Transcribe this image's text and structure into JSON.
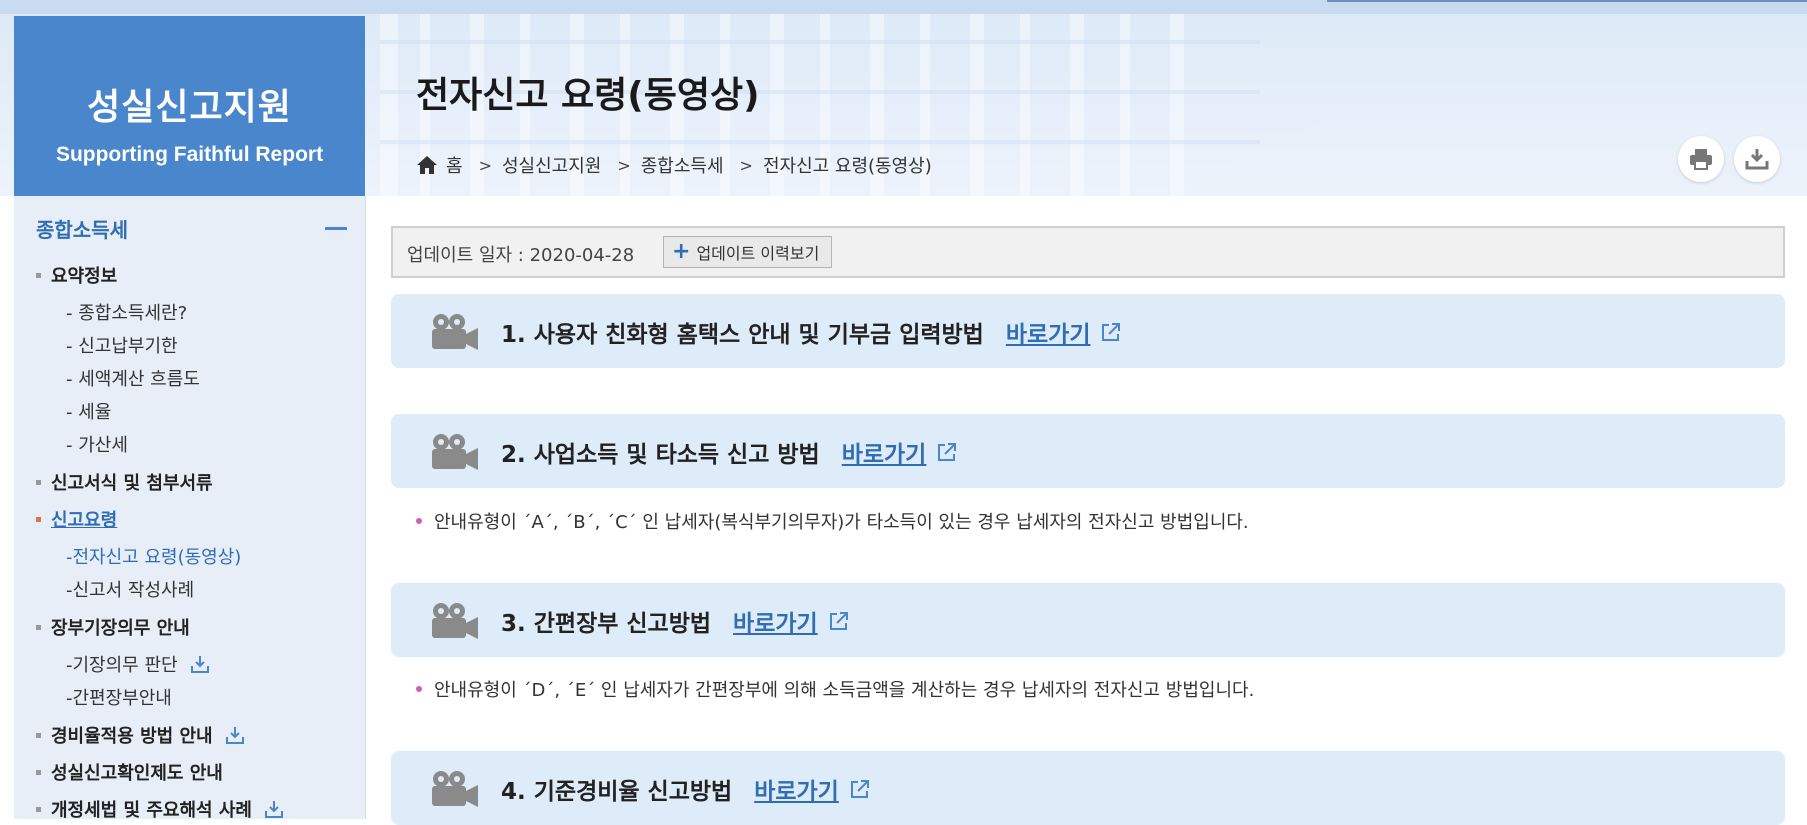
{
  "brand": {
    "title": "성실신고지원",
    "subtitle": "Supporting Faithful Report"
  },
  "header": {
    "title": "전자신고 요령(동영상)",
    "breadcrumb": [
      "홈",
      "성실신고지원",
      "종합소득세",
      "전자신고 요령(동영상)"
    ],
    "tools": [
      "print-icon",
      "download-icon"
    ]
  },
  "sidebar": {
    "heading": "종합소득세",
    "items": [
      {
        "label": "요약정보",
        "level": 1
      },
      {
        "label": "- 종합소득세란?",
        "level": 2
      },
      {
        "label": "- 신고납부기한",
        "level": 2
      },
      {
        "label": "- 세액계산 흐름도",
        "level": 2
      },
      {
        "label": "- 세율",
        "level": 2
      },
      {
        "label": "- 가산세",
        "level": 2
      },
      {
        "label": "신고서식 및 첨부서류",
        "level": 1
      },
      {
        "label": "신고요령",
        "level": 1
      },
      {
        "label": "-전자신고 요령(동영상)",
        "level": 2
      },
      {
        "label": "-신고서 작성사례",
        "level": 2
      },
      {
        "label": "장부기장의무 안내",
        "level": 1
      },
      {
        "label": "-기장의무 판단",
        "level": 2
      },
      {
        "label": "-간편장부안내",
        "level": 2
      },
      {
        "label": "경비율적용 방법 안내",
        "level": 1
      },
      {
        "label": "성실신고확인제도 안내",
        "level": 1
      },
      {
        "label": "개정세법 및 주요해석 사례",
        "level": 1
      }
    ]
  },
  "update": {
    "label": "업데이트 일자 : 2020-04-28",
    "button": "업데이트 이력보기"
  },
  "sections": [
    {
      "title": "1. 사용자 친화형 홈택스 안내 및 기부금 입력방법",
      "link": "바로가기",
      "desc": ""
    },
    {
      "title": "2. 사업소득 및 타소득 신고 방법",
      "link": "바로가기",
      "desc": "안내유형이 ´A´, ´B´, ´C´ 인 납세자(복식부기의무자)가 타소득이 있는 경우 납세자의 전자신고 방법입니다."
    },
    {
      "title": "3. 간편장부 신고방법",
      "link": "바로가기",
      "desc": "안내유형이 ´D´, ´E´ 인 납세자가 간편장부에 의해 소득금액을 계산하는 경우 납세자의 전자신고 방법입니다."
    },
    {
      "title": "4. 기준경비율 신고방법",
      "link": "바로가기",
      "desc": ""
    }
  ],
  "colors": {
    "brand": "#4a86cc",
    "link": "#2f6db5",
    "section_bg": "#deebf8",
    "bullet": "#d05fb0"
  }
}
